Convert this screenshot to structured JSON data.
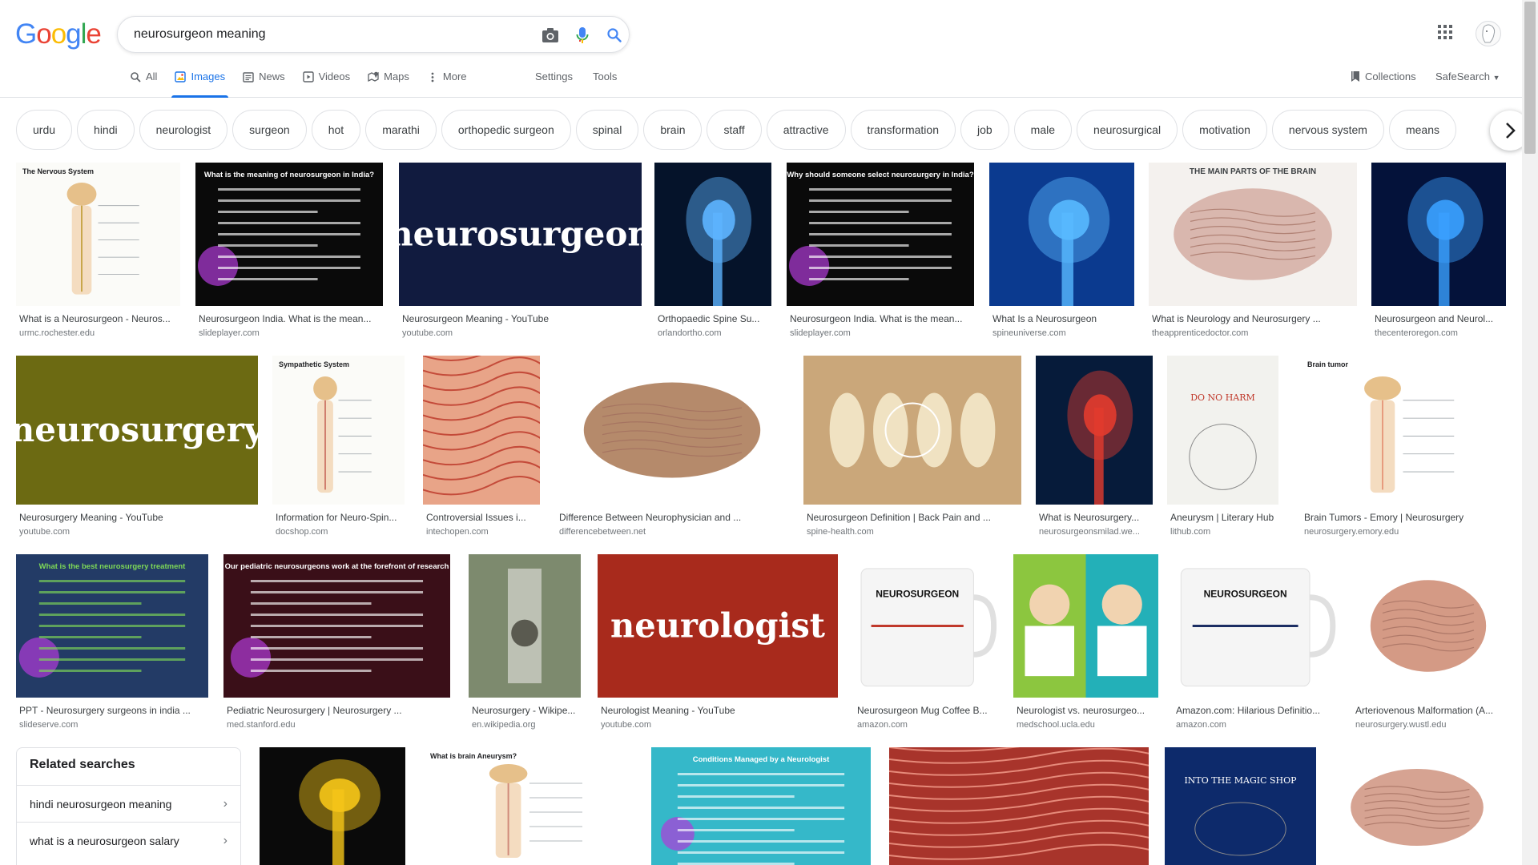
{
  "query": "neurosurgeon meaning",
  "logo_letters": [
    {
      "ch": "G",
      "color": "#4285F4"
    },
    {
      "ch": "o",
      "color": "#EA4335"
    },
    {
      "ch": "o",
      "color": "#FBBC05"
    },
    {
      "ch": "g",
      "color": "#4285F4"
    },
    {
      "ch": "l",
      "color": "#34A853"
    },
    {
      "ch": "e",
      "color": "#EA4335"
    }
  ],
  "tabs": [
    {
      "label": "All",
      "icon": "search-icon",
      "active": false
    },
    {
      "label": "Images",
      "icon": "image-icon",
      "active": true
    },
    {
      "label": "News",
      "icon": "news-icon",
      "active": false
    },
    {
      "label": "Videos",
      "icon": "video-icon",
      "active": false
    },
    {
      "label": "Maps",
      "icon": "map-icon",
      "active": false
    },
    {
      "label": "More",
      "icon": "more-vert-icon",
      "active": false
    }
  ],
  "settings_label": "Settings",
  "tools_label": "Tools",
  "collections_label": "Collections",
  "safesearch_label": "SafeSearch",
  "chips": [
    "urdu",
    "hindi",
    "neurologist",
    "surgeon",
    "hot",
    "marathi",
    "orthopedic surgeon",
    "spinal",
    "brain",
    "staff",
    "attractive",
    "transformation",
    "job",
    "male",
    "neurosurgical",
    "motivation",
    "nervous system",
    "means"
  ],
  "colors": {
    "accent": "#1a73e8",
    "site": "#70757a",
    "border": "#dfe1e5"
  },
  "images": [
    {
      "title": "What is a Neurosurgeon - Neuros...",
      "site": "urmc.rochester.edu",
      "style": "diagram",
      "bg": "#fbfbf8",
      "fg": "#c8a64a",
      "text": "The Nervous System"
    },
    {
      "title": "Neurosurgeon India. What is the mean...",
      "site": "slideplayer.com",
      "style": "slide",
      "bg": "#0a0a0a",
      "fg": "#ffffff",
      "text": "What is the meaning of neurosurgeon in India?"
    },
    {
      "title": "Neurosurgeon Meaning - YouTube",
      "site": "youtube.com",
      "style": "word",
      "bg": "#111b3f",
      "fg": "#ffffff",
      "text": "neurosurgeon"
    },
    {
      "title": "Orthopaedic Spine Su...",
      "site": "orlandortho.com",
      "style": "xray",
      "bg": "#05132a",
      "fg": "#5db4ff",
      "text": ""
    },
    {
      "title": "Neurosurgeon India. What is the mean...",
      "site": "slideplayer.com",
      "style": "slide",
      "bg": "#0a0a0a",
      "fg": "#ffffff",
      "text": "Why should someone select neurosurgery in India?"
    },
    {
      "title": "What Is a Neurosurgeon",
      "site": "spineuniverse.com",
      "style": "xray",
      "bg": "#0b3a8f",
      "fg": "#58b9ff",
      "text": ""
    },
    {
      "title": "What is Neurology and Neurosurgery ...",
      "site": "theapprenticedoctor.com",
      "style": "brain",
      "bg": "#f4f1ee",
      "fg": "#d9b7ae",
      "text": "THE MAIN PARTS OF THE BRAIN"
    },
    {
      "title": "Neurosurgeon and Neurol...",
      "site": "thecenteroregon.com",
      "style": "xray",
      "bg": "#04123a",
      "fg": "#3aa0ff",
      "text": ""
    },
    {
      "title": "Neurosurgery Meaning - YouTube",
      "site": "youtube.com",
      "style": "word",
      "bg": "#6c6a12",
      "fg": "#ffffff",
      "text": "neurosurgery"
    },
    {
      "title": "Information for Neuro-Spin...",
      "site": "docshop.com",
      "style": "diagram",
      "bg": "#fbfbf8",
      "fg": "#d07f6e",
      "text": "Sympathetic System"
    },
    {
      "title": "Controversial Issues i...",
      "site": "intechopen.com",
      "style": "tissue",
      "bg": "#e8a488",
      "fg": "#c44b3a",
      "text": ""
    },
    {
      "title": "Difference Between Neurophysician and ...",
      "site": "differencebetween.net",
      "style": "brain",
      "bg": "#ffffff",
      "fg": "#b58a6b",
      "text": ""
    },
    {
      "title": "Neurosurgeon Definition | Back Pain and ...",
      "site": "spine-health.com",
      "style": "bones",
      "bg": "#caa77a",
      "fg": "#f0e2c2",
      "text": ""
    },
    {
      "title": "What is Neurosurgery...",
      "site": "neurosurgeonsmilad.we...",
      "style": "xray",
      "bg": "#061b3a",
      "fg": "#e23b2e",
      "text": ""
    },
    {
      "title": "Aneurysm | Literary Hub",
      "site": "lithub.com",
      "style": "book",
      "bg": "#f2f2ee",
      "fg": "#c0392b",
      "text": "DO NO HARM"
    },
    {
      "title": "Brain Tumors - Emory | Neurosurgery",
      "site": "neurosurgery.emory.edu",
      "style": "diagram",
      "bg": "#ffffff",
      "fg": "#e79b7e",
      "text": "Brain tumor"
    },
    {
      "title": "PPT - Neurosurgery surgeons in india ...",
      "site": "slideserve.com",
      "style": "slide",
      "bg": "#233b66",
      "fg": "#7ed957",
      "text": "What is the best neurosurgery treatment"
    },
    {
      "title": "Pediatric Neurosurgery | Neurosurgery ...",
      "site": "med.stanford.edu",
      "style": "slide",
      "bg": "#3a0f18",
      "fg": "#ffffff",
      "text": "Our pediatric neurosurgeons work at the forefront of research"
    },
    {
      "title": "Neurosurgery - Wikipe...",
      "site": "en.wikipedia.org",
      "style": "photo",
      "bg": "#7d8a6e",
      "fg": "#d9d9d2",
      "text": ""
    },
    {
      "title": "Neurologist Meaning - YouTube",
      "site": "youtube.com",
      "style": "word",
      "bg": "#a82a1c",
      "fg": "#ffffff",
      "text": "neurologist"
    },
    {
      "title": "Neurosurgeon Mug Coffee B...",
      "site": "amazon.com",
      "style": "mug",
      "bg": "#ffffff",
      "fg": "#c0392b",
      "text": "NEUROSURGEON"
    },
    {
      "title": "Neurologist vs. neurosurgeo...",
      "site": "medschool.ucla.edu",
      "style": "cartoon",
      "bg": "#8cc63f",
      "fg": "#ffffff",
      "text": ""
    },
    {
      "title": "Amazon.com: Hilarious Definitio...",
      "site": "amazon.com",
      "style": "mug",
      "bg": "#ffffff",
      "fg": "#1c2e63",
      "text": "NEUROSURGEON"
    },
    {
      "title": "Arteriovenous Malformation (A...",
      "site": "neurosurgery.wustl.edu",
      "style": "brain",
      "bg": "#ffffff",
      "fg": "#d49a85",
      "text": ""
    },
    {
      "title": "",
      "site": "",
      "style": "xray",
      "bg": "#0a0a0a",
      "fg": "#f5c518",
      "text": ""
    },
    {
      "title": "",
      "site": "",
      "style": "diagram",
      "bg": "#ffffff",
      "fg": "#d08a7a",
      "text": "What is brain Aneurysm?"
    },
    {
      "title": "",
      "site": "",
      "style": "slide",
      "bg": "#35b8c9",
      "fg": "#ffffff",
      "text": "Conditions Managed by a Neurologist"
    },
    {
      "title": "",
      "site": "",
      "style": "tissue",
      "bg": "#a8342b",
      "fg": "#e68a7a",
      "text": ""
    },
    {
      "title": "",
      "site": "",
      "style": "book",
      "bg": "#0d2a6b",
      "fg": "#ffffff",
      "text": "INTO THE MAGIC SHOP"
    },
    {
      "title": "",
      "site": "",
      "style": "brain",
      "bg": "#ffffff",
      "fg": "#d6a392",
      "text": ""
    }
  ],
  "related": {
    "heading": "Related searches",
    "items": [
      "hindi neurosurgeon meaning",
      "what is a neurosurgeon salary"
    ]
  }
}
